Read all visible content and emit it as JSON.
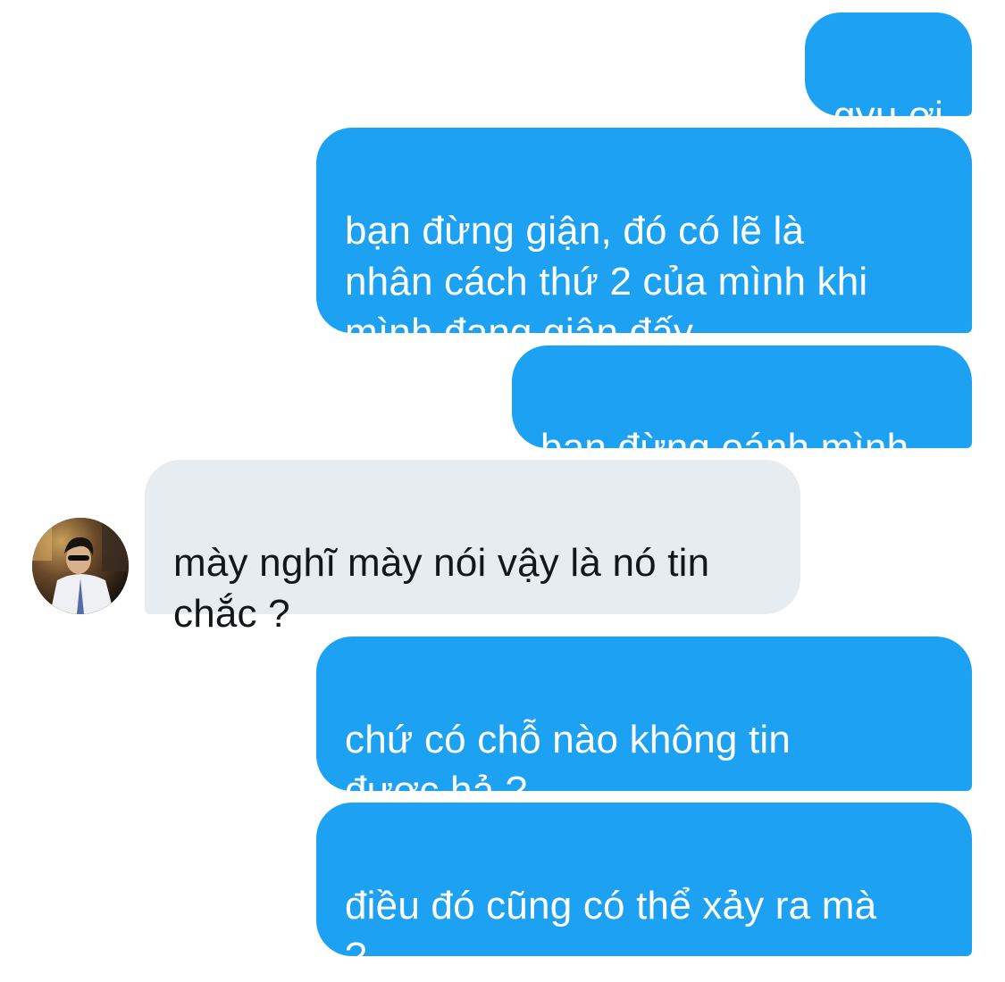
{
  "conversation": {
    "messages": [
      {
        "direction": "outgoing",
        "text": "gyu ơi"
      },
      {
        "direction": "outgoing",
        "text": "bạn đừng giận, đó có lẽ là\nnhân cách thứ 2 của mình khi\nmình đang giận đấy"
      },
      {
        "direction": "outgoing",
        "text": "bạn đừng oánh mình"
      },
      {
        "direction": "incoming",
        "text": "mày nghĩ mày nói vậy là nó tin\nchắc ?"
      },
      {
        "direction": "outgoing",
        "text": "chứ có chỗ nào không tin\nđược hả ?"
      },
      {
        "direction": "outgoing",
        "text": "điều đó cũng có thể xảy ra mà\n?"
      }
    ],
    "avatar": {
      "icon": "user-avatar-photo"
    }
  },
  "colors": {
    "outgoing_bubble": "#1da1f2",
    "incoming_bubble": "#e6ecf0",
    "incoming_text": "#14171a",
    "background": "#ffffff"
  }
}
